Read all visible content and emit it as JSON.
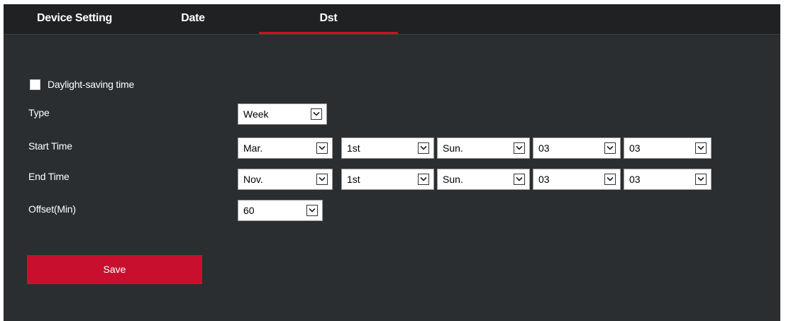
{
  "tabs": [
    {
      "label": "Device Setting",
      "active": false
    },
    {
      "label": "Date",
      "active": false
    },
    {
      "label": "Dst",
      "active": true
    }
  ],
  "dst": {
    "checkbox_label": "Daylight-saving time",
    "checked": false,
    "type": {
      "label": "Type",
      "value": "Week"
    },
    "start_time": {
      "label": "Start Time",
      "month": "Mar.",
      "week": "1st",
      "day": "Sun.",
      "hour": "03",
      "minute": "03"
    },
    "end_time": {
      "label": "End Time",
      "month": "Nov.",
      "week": "1st",
      "day": "Sun.",
      "hour": "03",
      "minute": "03"
    },
    "offset": {
      "label": "Offset(Min)",
      "value": "60"
    },
    "save_label": "Save"
  },
  "colors": {
    "background": "#2b2e31",
    "tab_bar": "#1f2123",
    "accent": "#c8102e"
  },
  "icons": {
    "dropdown": "chevron-down-icon"
  }
}
